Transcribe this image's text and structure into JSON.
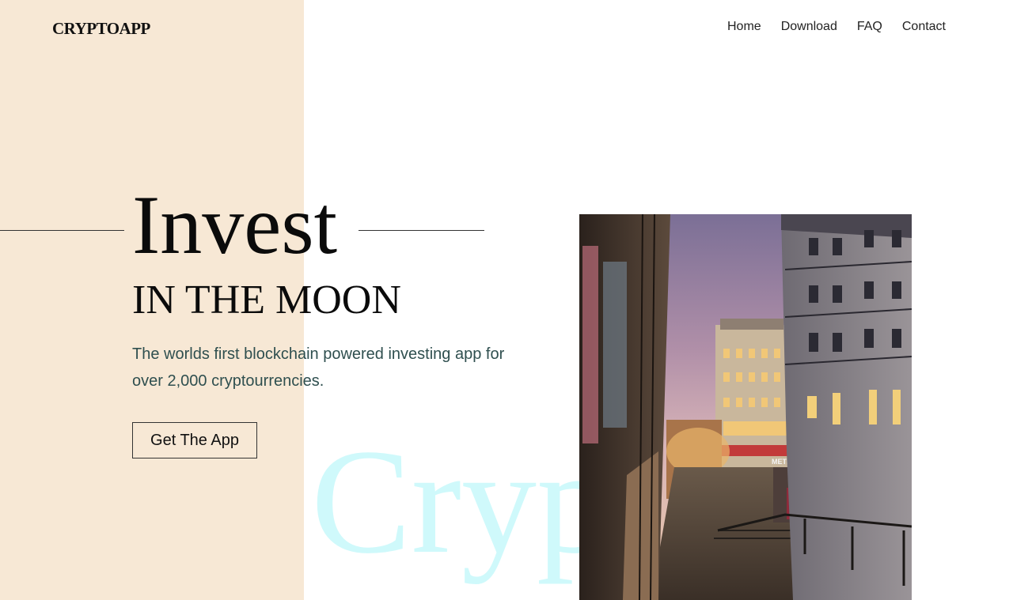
{
  "header": {
    "logo": "CRYPTOAPP",
    "nav": [
      {
        "label": "Home"
      },
      {
        "label": "Download"
      },
      {
        "label": "FAQ"
      },
      {
        "label": "Contact"
      }
    ]
  },
  "hero": {
    "title": "Invest",
    "subtitle": "IN THE MOON",
    "description": "The worlds first blockchain powered investing app for over 2,000 cryptourrencies.",
    "cta_label": "Get The App",
    "watermark": "Cryptoinc"
  },
  "photo": {
    "sign_text": "METROPOLIT"
  },
  "colors": {
    "panel": "#f7e8d5",
    "watermark": "#cdf9fb",
    "description": "#2f4f4f"
  }
}
